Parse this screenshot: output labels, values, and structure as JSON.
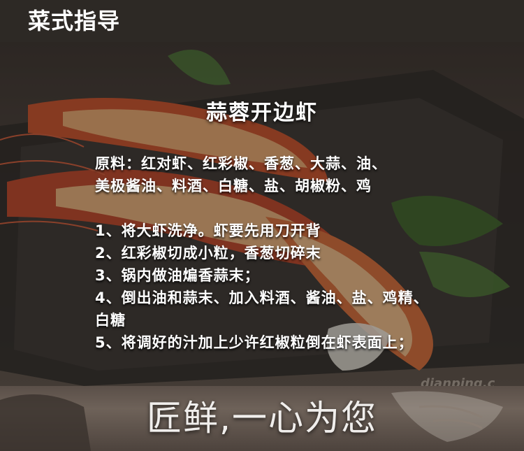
{
  "header": {
    "title": "菜式指导"
  },
  "recipe": {
    "title": "蒜蓉开边虾",
    "ingredients_line1": "原料：红对虾、红彩椒、香葱、大蒜、油、",
    "ingredients_line2": "美极酱油、料酒、白糖、盐、胡椒粉、鸡",
    "steps": [
      "1、将大虾洗净。虾要先用刀开背",
      "2、红彩椒切成小粒，香葱切碎末",
      "3、锅内做油煸香蒜末；",
      "4、倒出油和蒜末、加入料酒、酱油、盐、鸡精、",
      "白糖",
      "5、将调好的汁加上少许红椒粒倒在虾表面上；"
    ]
  },
  "watermark": {
    "text": "dianping.c"
  },
  "footer": {
    "slogan": "匠鲜,一心为您"
  }
}
